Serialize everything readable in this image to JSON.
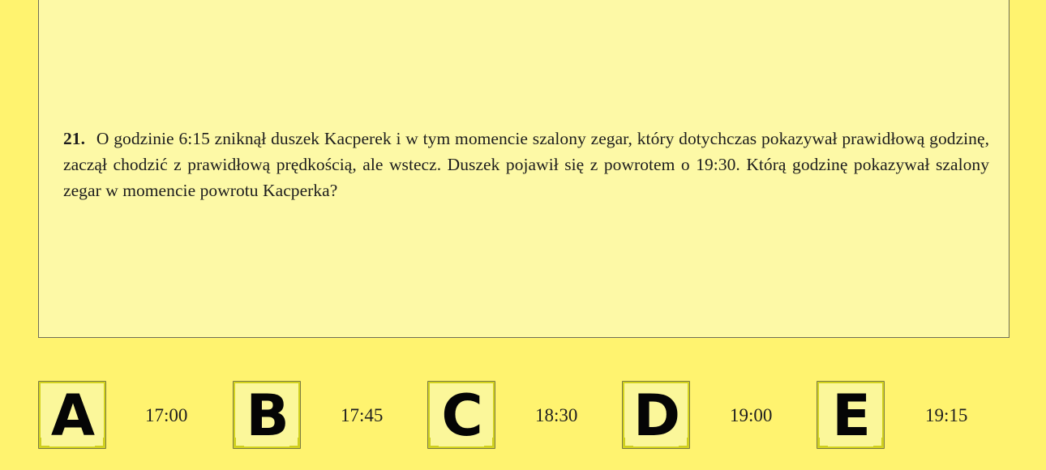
{
  "question": {
    "number": "21.",
    "text": "O godzinie 6:15 zniknął duszek Kacperek i w tym momencie szalony zegar, który dotychczas pokazywał prawidłową godzinę, zaczął chodzić z prawidłową prędkością, ale wstecz. Duszek pojawił się z powrotem o 19:30. Którą godzinę pokazywał szalony zegar w momencie powrotu Kacperka?"
  },
  "answers": [
    {
      "letter": "A",
      "value": "17:00"
    },
    {
      "letter": "B",
      "value": "17:45"
    },
    {
      "letter": "C",
      "value": "18:30"
    },
    {
      "letter": "D",
      "value": "19:00"
    },
    {
      "letter": "E",
      "value": "19:15"
    }
  ],
  "colors": {
    "page_background": "#fff36f",
    "question_background": "#fdf9a6",
    "letter_box_outline": "#d3d21f"
  }
}
